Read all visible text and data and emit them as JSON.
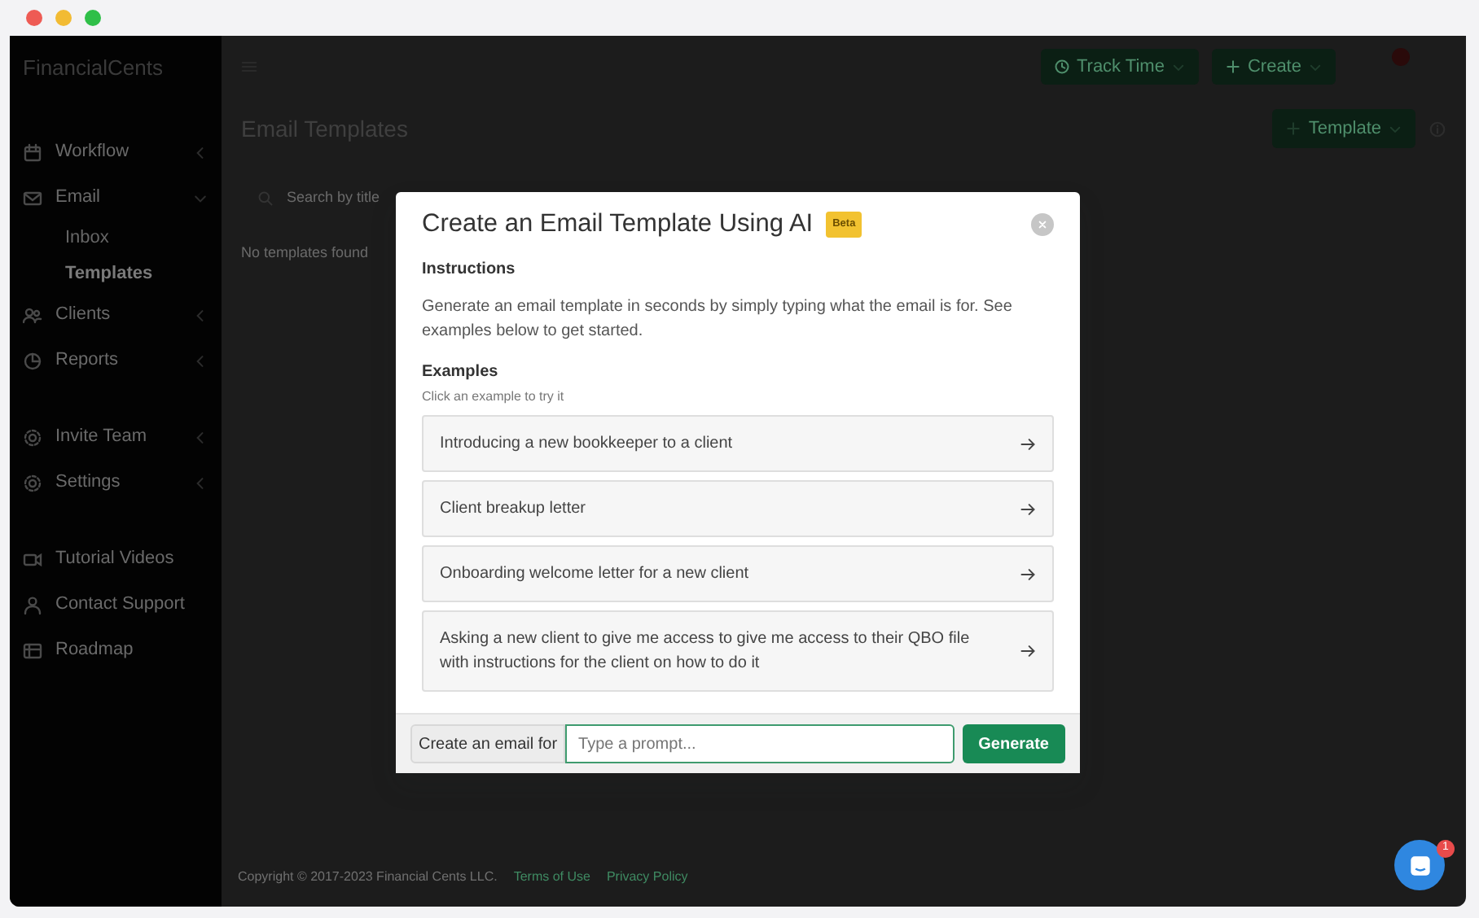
{
  "sidebar": {
    "brand": "FinancialCents",
    "items": [
      {
        "label": "Workflow",
        "expanded": false
      },
      {
        "label": "Email",
        "expanded": true,
        "children": [
          {
            "label": "Inbox",
            "selected": false
          },
          {
            "label": "Templates",
            "selected": true
          }
        ]
      },
      {
        "label": "Clients",
        "expanded": false
      },
      {
        "label": "Reports",
        "expanded": false
      },
      {
        "label": "Invite Team",
        "expanded": false
      },
      {
        "label": "Settings",
        "expanded": false
      },
      {
        "label": "Tutorial Videos"
      },
      {
        "label": "Contact Support"
      },
      {
        "label": "Roadmap"
      }
    ]
  },
  "topbar": {
    "buttons": [
      {
        "label": "Track Time"
      },
      {
        "label": "Create"
      }
    ]
  },
  "page": {
    "title": "Email Templates",
    "add_button": "Template",
    "search": {
      "placeholder": "Search by title"
    },
    "empty_text": "No templates found"
  },
  "footer": {
    "copyright": "Copyright © 2017-2023 Financial Cents LLC.",
    "links": [
      "Terms of Use",
      "Privacy Policy"
    ]
  },
  "modal": {
    "title": "Create an Email Template Using AI",
    "badge": "Beta",
    "instructions_heading": "Instructions",
    "instructions_text": "Generate an email template in seconds by simply typing what the email is for. See examples below to get started.",
    "examples_heading": "Examples",
    "examples_hint": "Click an example to try it",
    "examples": [
      "Introducing a new bookkeeper to a client",
      "Client breakup letter",
      "Onboarding welcome letter for a new client",
      "Asking a new client to give me access to give me access to their QBO file with instructions for the client on how to do it"
    ],
    "prompt": {
      "label": "Create an email for",
      "placeholder": "Type a prompt..."
    },
    "generate_button": "Generate"
  },
  "chat": {
    "badge": "1"
  }
}
